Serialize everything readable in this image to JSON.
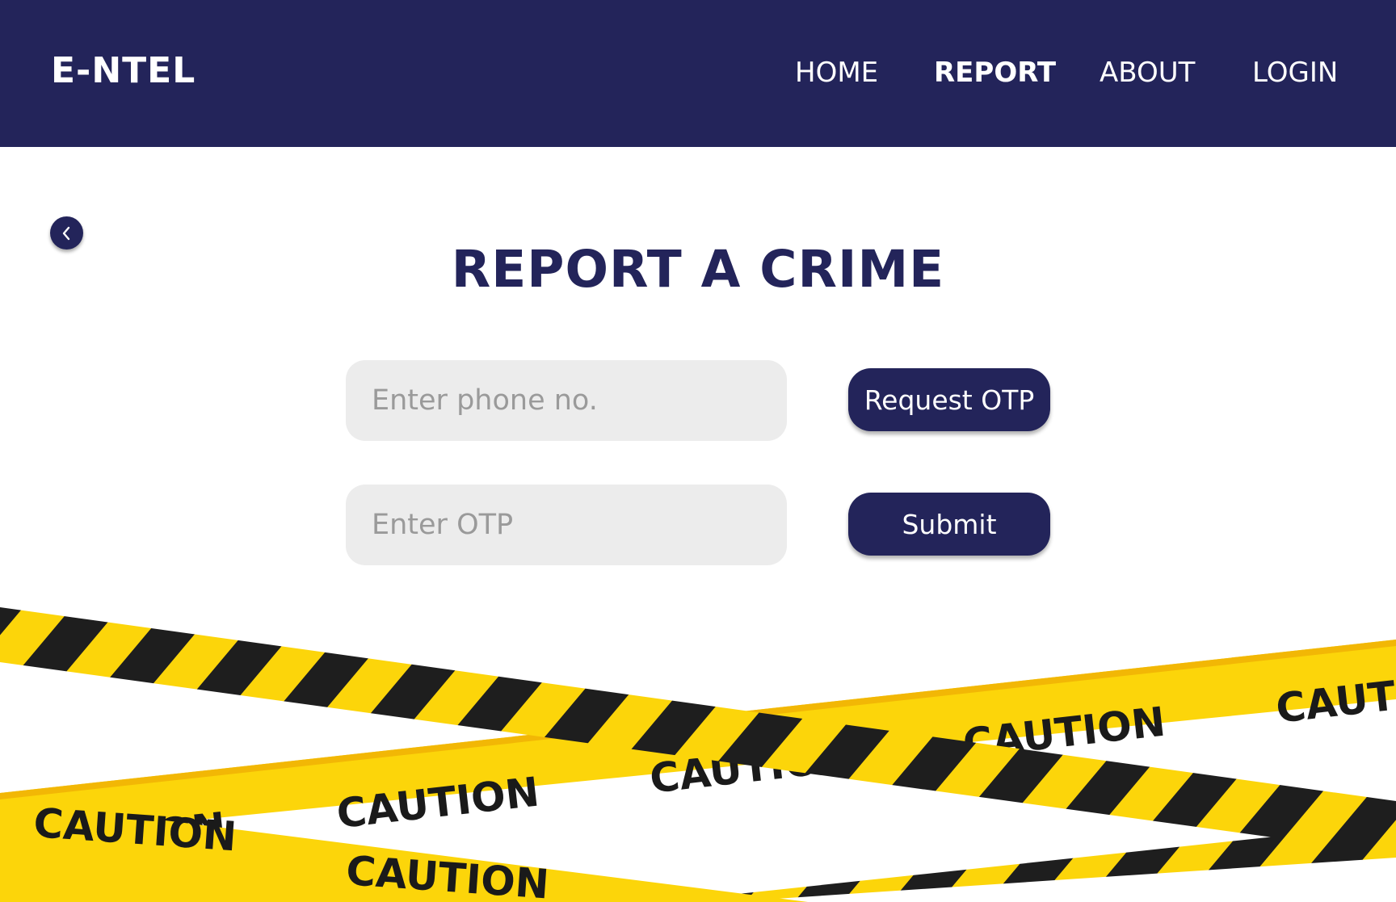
{
  "header": {
    "brand": "E-NTEL",
    "nav": [
      {
        "label": "HOME",
        "active": false
      },
      {
        "label": "REPORT",
        "active": true
      },
      {
        "label": "ABOUT",
        "active": false
      },
      {
        "label": "LOGIN",
        "active": false
      }
    ]
  },
  "main": {
    "back_icon": "chevron-left-icon",
    "title": "REPORT A CRIME",
    "phone_field": {
      "value": "",
      "placeholder": "Enter phone no."
    },
    "otp_field": {
      "value": "",
      "placeholder": "Enter OTP"
    },
    "request_otp_label": "Request OTP",
    "submit_label": "Submit"
  },
  "illustration": {
    "tape_text": "CAUTION"
  },
  "colors": {
    "primary": "#23245a",
    "background": "#ffffff",
    "input_background": "#ececec",
    "placeholder": "#9a9a9a",
    "tape_yellow": "#fcd50a",
    "tape_black": "#1e1e1e"
  }
}
